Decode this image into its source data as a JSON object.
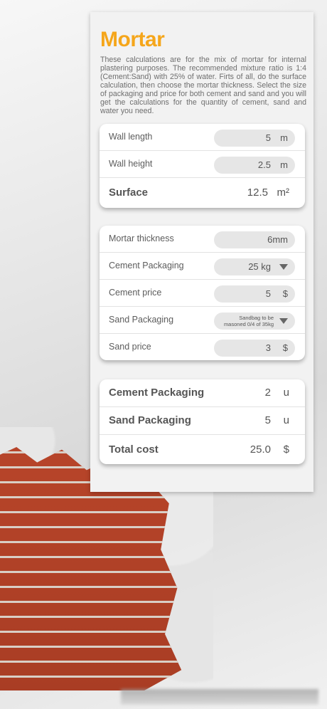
{
  "title": "Mortar",
  "description": "These calculations are for the mix of mortar for internal plastering purposes. The recommended mixture ratio is 1:4 (Cement:Sand) with 25% of water. Firts of all, do the surface calculation, then choose the mortar thickness. Select the size of packaging and price for both cement and sand and you will get the calculations for the quantity of cement, sand and water you need.",
  "surface_card": {
    "wall_length": {
      "label": "Wall length",
      "value": "5",
      "unit": "m"
    },
    "wall_height": {
      "label": "Wall height",
      "value": "2.5",
      "unit": "m"
    },
    "surface": {
      "label": "Surface",
      "value": "12.5",
      "unit": "m²"
    }
  },
  "input_card": {
    "mortar_thickness": {
      "label": "Mortar thickness",
      "value": "6mm"
    },
    "cement_packaging": {
      "label": "Cement Packaging",
      "value": "25 kg"
    },
    "cement_price": {
      "label": "Cement price",
      "value": "5",
      "unit": "$"
    },
    "sand_packaging": {
      "label": "Sand Packaging",
      "value": "Sandbag to be masoned 0/4 of 35kg"
    },
    "sand_price": {
      "label": "Sand price",
      "value": "3",
      "unit": "$"
    }
  },
  "result_card": {
    "cement_packaging": {
      "label": "Cement Packaging",
      "value": "2",
      "unit": "u"
    },
    "sand_packaging": {
      "label": "Sand Packaging",
      "value": "5",
      "unit": "u"
    },
    "total_cost": {
      "label": "Total cost",
      "value": "25.0",
      "unit": "$"
    }
  },
  "colors": {
    "accent": "#f5a61b"
  }
}
